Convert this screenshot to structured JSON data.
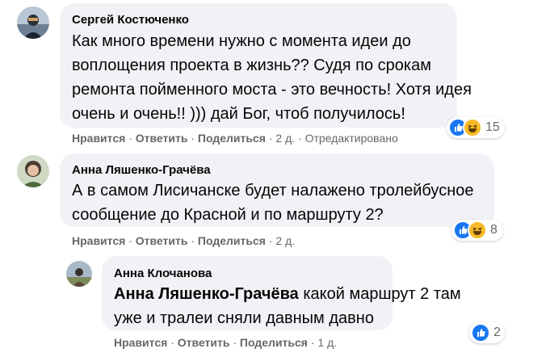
{
  "colors": {
    "bubble_bg": "#f0f2f5",
    "action_text": "#65676b",
    "like_blue": "#1877f2",
    "haha_yellow": "#f7b928"
  },
  "comments": [
    {
      "author": "Сергей Костюченко",
      "lines": [
        "Как много времени нужно с момента идеи до",
        "воплощения проекта в жизнь?? Судя по срокам",
        "ремонта пойменного моста - это вечность! Хотя идея",
        "очень и очень!! ))) дай Бог, чтоб получилось!"
      ],
      "actions": {
        "like": "Нравится",
        "reply": "Ответить",
        "share": "Поделиться",
        "time": "2 д.",
        "edited": "Отредактировано"
      },
      "reactions": {
        "icons": [
          "like-icon",
          "haha-icon"
        ],
        "count": "15"
      }
    },
    {
      "author": "Анна Ляшенко-Грачёва",
      "lines": [
        "А в самом Лисичанске будет налажено тролейбусное",
        "сообщение до Красной и по маршруту 2?"
      ],
      "actions": {
        "like": "Нравится",
        "reply": "Ответить",
        "share": "Поделиться",
        "time": "2 д."
      },
      "reactions": {
        "icons": [
          "like-icon",
          "haha-icon"
        ],
        "count": "8"
      }
    },
    {
      "author": "Анна Клочанова",
      "mention": "Анна Ляшенко-Грачёва",
      "line1_rest": " какой маршрут 2 там",
      "line2": "уже и тралеи сняли давным давно",
      "actions": {
        "like": "Нравится",
        "reply": "Ответить",
        "share": "Поделиться",
        "time": "1 д."
      },
      "reactions": {
        "icons": [
          "like-icon"
        ],
        "count": "2"
      }
    }
  ],
  "separator": "·"
}
